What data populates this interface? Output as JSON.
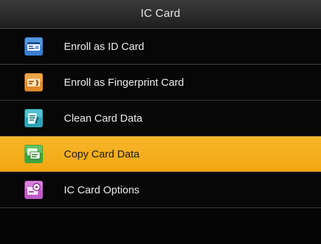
{
  "header": {
    "title": "IC Card"
  },
  "menu": {
    "items": [
      {
        "label": "Enroll as ID Card",
        "icon": "id-card-icon",
        "color": "#3a7fd0"
      },
      {
        "label": "Enroll as Fingerprint Card",
        "icon": "fingerprint-card-icon",
        "color": "#e08a2a"
      },
      {
        "label": "Clean Card Data",
        "icon": "clean-card-data-icon",
        "color": "#2aa6b8"
      },
      {
        "label": "Copy Card Data",
        "icon": "copy-card-data-icon",
        "color": "#3aa43e",
        "selected": true
      },
      {
        "label": "IC Card Options",
        "icon": "card-options-icon",
        "color": "#c05ac8"
      }
    ]
  },
  "colors": {
    "highlight": "#f4ac1c",
    "background": "#050505",
    "text": "#ededed"
  }
}
